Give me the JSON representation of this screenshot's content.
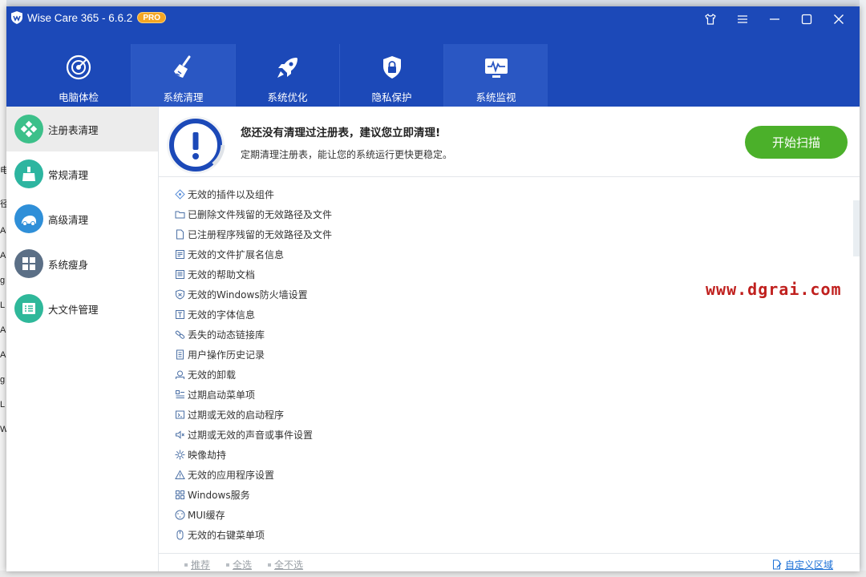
{
  "app": {
    "title": "Wise Care 365 - 6.6.2",
    "badge": "PRO",
    "accent": "#1c49b8",
    "active_tab_color": "#2a57c3"
  },
  "window_controls": {
    "skin": "tshirt-icon",
    "menu": "menu-icon",
    "minimize": "minimize-icon",
    "maximize": "maximize-icon",
    "close": "close-icon"
  },
  "main_tabs": [
    {
      "label": "电脑体检",
      "icon": "radar-icon"
    },
    {
      "label": "系统清理",
      "icon": "broom-icon",
      "active": true
    },
    {
      "label": "系统优化",
      "icon": "rocket-icon"
    },
    {
      "label": "隐私保护",
      "icon": "lock-shield-icon"
    },
    {
      "label": "系统监视",
      "icon": "monitor-icon",
      "active": true
    }
  ],
  "sidebar": {
    "items": [
      {
        "label": "注册表清理",
        "icon": "registry-icon",
        "color": "#3cc08a",
        "active": true
      },
      {
        "label": "常规清理",
        "icon": "broom-icon",
        "color": "#2db5a0"
      },
      {
        "label": "高级清理",
        "icon": "vacuum-icon",
        "color": "#2f8fd8"
      },
      {
        "label": "系统瘦身",
        "icon": "windows-icon",
        "color": "#5b6f86"
      },
      {
        "label": "大文件管理",
        "icon": "file-list-icon",
        "color": "#2fb89a"
      }
    ]
  },
  "header": {
    "title": "您还没有清理过注册表，建议您立即清理!",
    "subtitle": "定期清理注册表，能让您的系统运行更快更稳定。",
    "scan_button": "开始扫描",
    "scan_color": "#4bb02a"
  },
  "items": [
    {
      "label": "无效的插件以及组件",
      "icon": "plugin-icon"
    },
    {
      "label": "已删除文件残留的无效路径及文件",
      "icon": "folder-icon"
    },
    {
      "label": "已注册程序残留的无效路径及文件",
      "icon": "file-icon"
    },
    {
      "label": "无效的文件扩展名信息",
      "icon": "file-ext-icon"
    },
    {
      "label": "无效的帮助文档",
      "icon": "help-doc-icon"
    },
    {
      "label": "无效的Windows防火墙设置",
      "icon": "firewall-shield-icon"
    },
    {
      "label": "无效的字体信息",
      "icon": "font-icon"
    },
    {
      "label": "丢失的动态链接库",
      "icon": "link-icon"
    },
    {
      "label": "用户操作历史记录",
      "icon": "history-doc-icon"
    },
    {
      "label": "无效的卸载",
      "icon": "uninstall-icon"
    },
    {
      "label": "过期启动菜单项",
      "icon": "start-menu-icon"
    },
    {
      "label": "过期或无效的启动程序",
      "icon": "startup-icon"
    },
    {
      "label": "过期或无效的声音或事件设置",
      "icon": "sound-icon"
    },
    {
      "label": "映像劫持",
      "icon": "gear-icon"
    },
    {
      "label": "无效的应用程序设置",
      "icon": "warning-icon"
    },
    {
      "label": "Windows服务",
      "icon": "services-icon"
    },
    {
      "label": "MUI缓存",
      "icon": "cache-icon"
    },
    {
      "label": "无效的右键菜单项",
      "icon": "mouse-icon"
    }
  ],
  "footer": {
    "recommend": "推荐",
    "select_all": "全选",
    "select_none": "全不选",
    "custom_area": "自定义区域"
  },
  "watermark": "www.dgrai.com",
  "background_fragments": [
    "电",
    "径",
    "A",
    "A",
    "g",
    "L",
    "A",
    "A",
    "g",
    "L",
    "W"
  ]
}
